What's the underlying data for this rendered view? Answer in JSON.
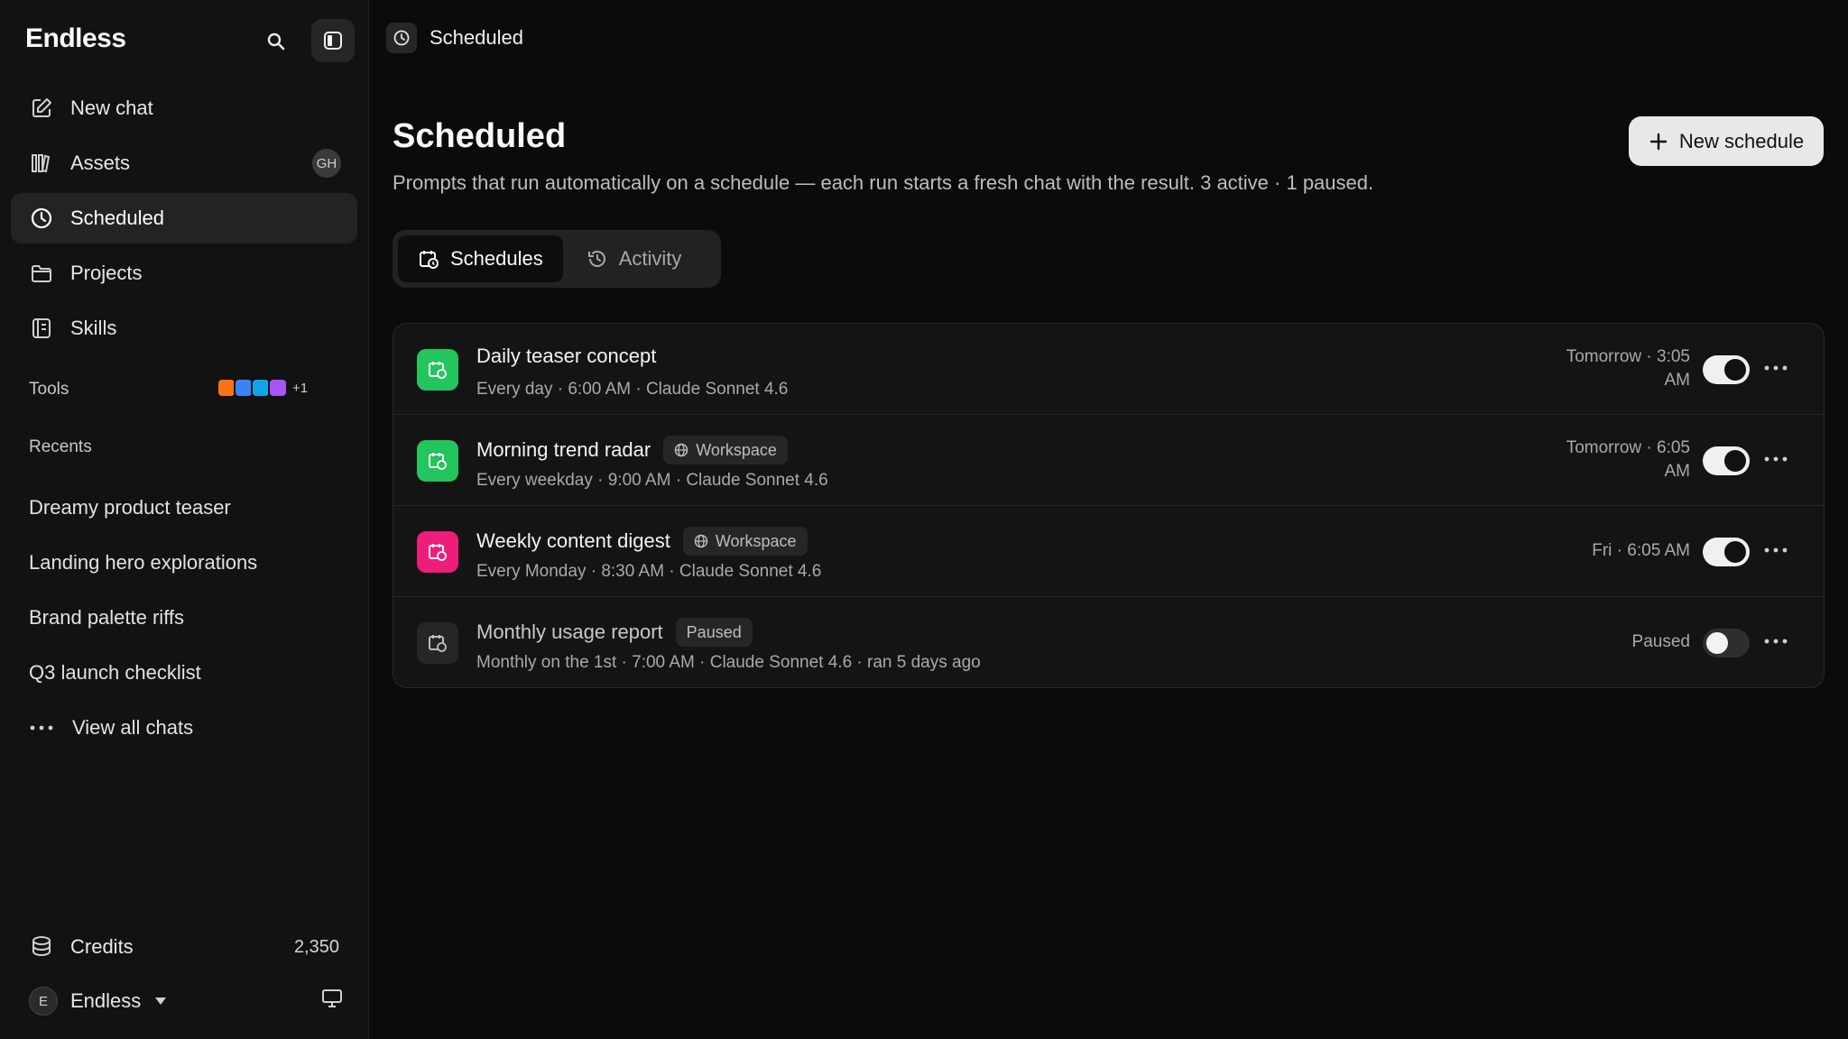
{
  "sidebar": {
    "brand": "Endless",
    "nav": [
      {
        "label": "New chat",
        "icon": "edit-icon"
      },
      {
        "label": "Assets",
        "icon": "assets-icon",
        "badge": "GH"
      },
      {
        "label": "Scheduled",
        "icon": "clock-icon",
        "active": true
      },
      {
        "label": "Projects",
        "icon": "folder-icon"
      },
      {
        "label": "Skills",
        "icon": "skills-icon"
      }
    ],
    "tools_label": "Tools",
    "tools_count": "+1",
    "recents_label": "Recents",
    "recents": [
      "Dreamy product teaser",
      "Landing hero explorations",
      "Brand palette riffs",
      "Q3 launch checklist"
    ],
    "view_all": "View all chats",
    "credits_label": "Credits",
    "credits_value": "2,350",
    "user_initial": "E",
    "user_name": "Endless"
  },
  "header": {
    "crumb": "Scheduled",
    "title": "Scheduled",
    "subtitle": "Prompts that run automatically on a schedule — each run starts a fresh chat with the result. 3 active · 1 paused.",
    "new_schedule": "New schedule"
  },
  "tabs": [
    {
      "label": "Schedules",
      "active": true
    },
    {
      "label": "Activity",
      "active": false
    }
  ],
  "schedules": [
    {
      "title": "Daily teaser concept",
      "tag": "",
      "sub": "Every day · 6:00 AM · Claude Sonnet 4.6",
      "next_line1": "Tomorrow · 3:05",
      "next_line2": "AM",
      "enabled": true,
      "color": "#22c55e"
    },
    {
      "title": "Morning trend radar",
      "tag": "Workspace",
      "sub": "Every weekday · 9:00 AM · Claude Sonnet 4.6",
      "next_line1": "Tomorrow · 6:05",
      "next_line2": "AM",
      "enabled": true,
      "color": "#22c55e"
    },
    {
      "title": "Weekly content digest",
      "tag": "Workspace",
      "sub": "Every Monday · 8:30 AM · Claude Sonnet 4.6",
      "next_line1": "Fri · 6:05 AM",
      "next_line2": "",
      "enabled": true,
      "color": "#ec1e79"
    },
    {
      "title": "Monthly usage report",
      "tag": "Paused",
      "sub": "Monthly on the 1st · 7:00 AM · Claude Sonnet 4.6 · ran 5 days ago",
      "next_line1": "Paused",
      "next_line2": "",
      "enabled": false,
      "color": "#262626"
    }
  ]
}
